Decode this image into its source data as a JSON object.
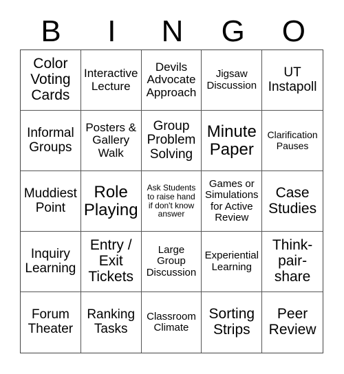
{
  "header": {
    "letters": [
      "B",
      "I",
      "N",
      "G",
      "O"
    ]
  },
  "cells": [
    {
      "text": "Color\nVoting\nCards",
      "size": "s-l"
    },
    {
      "text": "Interactive\nLecture",
      "size": "s-sm"
    },
    {
      "text": "Devils\nAdvocate\nApproach",
      "size": "s-sm"
    },
    {
      "text": "Jigsaw\nDiscussion",
      "size": "s-s"
    },
    {
      "text": "UT\nInstapoll",
      "size": "s-m"
    },
    {
      "text": "Informal\nGroups",
      "size": "s-m"
    },
    {
      "text": "Posters &\nGallery\nWalk",
      "size": "s-sm"
    },
    {
      "text": "Group\nProblem\nSolving",
      "size": "s-m"
    },
    {
      "text": "Minute\nPaper",
      "size": "s-xl"
    },
    {
      "text": "Clarification\nPauses",
      "size": "s-xs"
    },
    {
      "text": "Muddiest\nPoint",
      "size": "s-m"
    },
    {
      "text": "Role\nPlaying",
      "size": "s-xl"
    },
    {
      "text": "Ask Students\nto raise hand\nif don't know\nanswer",
      "size": "s-xxs"
    },
    {
      "text": "Games or\nSimulations\nfor Active\nReview",
      "size": "s-s"
    },
    {
      "text": "Case\nStudies",
      "size": "s-l"
    },
    {
      "text": "Inquiry\nLearning",
      "size": "s-m"
    },
    {
      "text": "Entry /\nExit\nTickets",
      "size": "s-l"
    },
    {
      "text": "Large\nGroup\nDiscussion",
      "size": "s-s"
    },
    {
      "text": "Experiential\nLearning",
      "size": "s-s"
    },
    {
      "text": "Think-\npair-\nshare",
      "size": "s-l"
    },
    {
      "text": "Forum\nTheater",
      "size": "s-m"
    },
    {
      "text": "Ranking\nTasks",
      "size": "s-m"
    },
    {
      "text": "Classroom\nClimate",
      "size": "s-s"
    },
    {
      "text": "Sorting\nStrips",
      "size": "s-l"
    },
    {
      "text": "Peer\nReview",
      "size": "s-l"
    }
  ]
}
